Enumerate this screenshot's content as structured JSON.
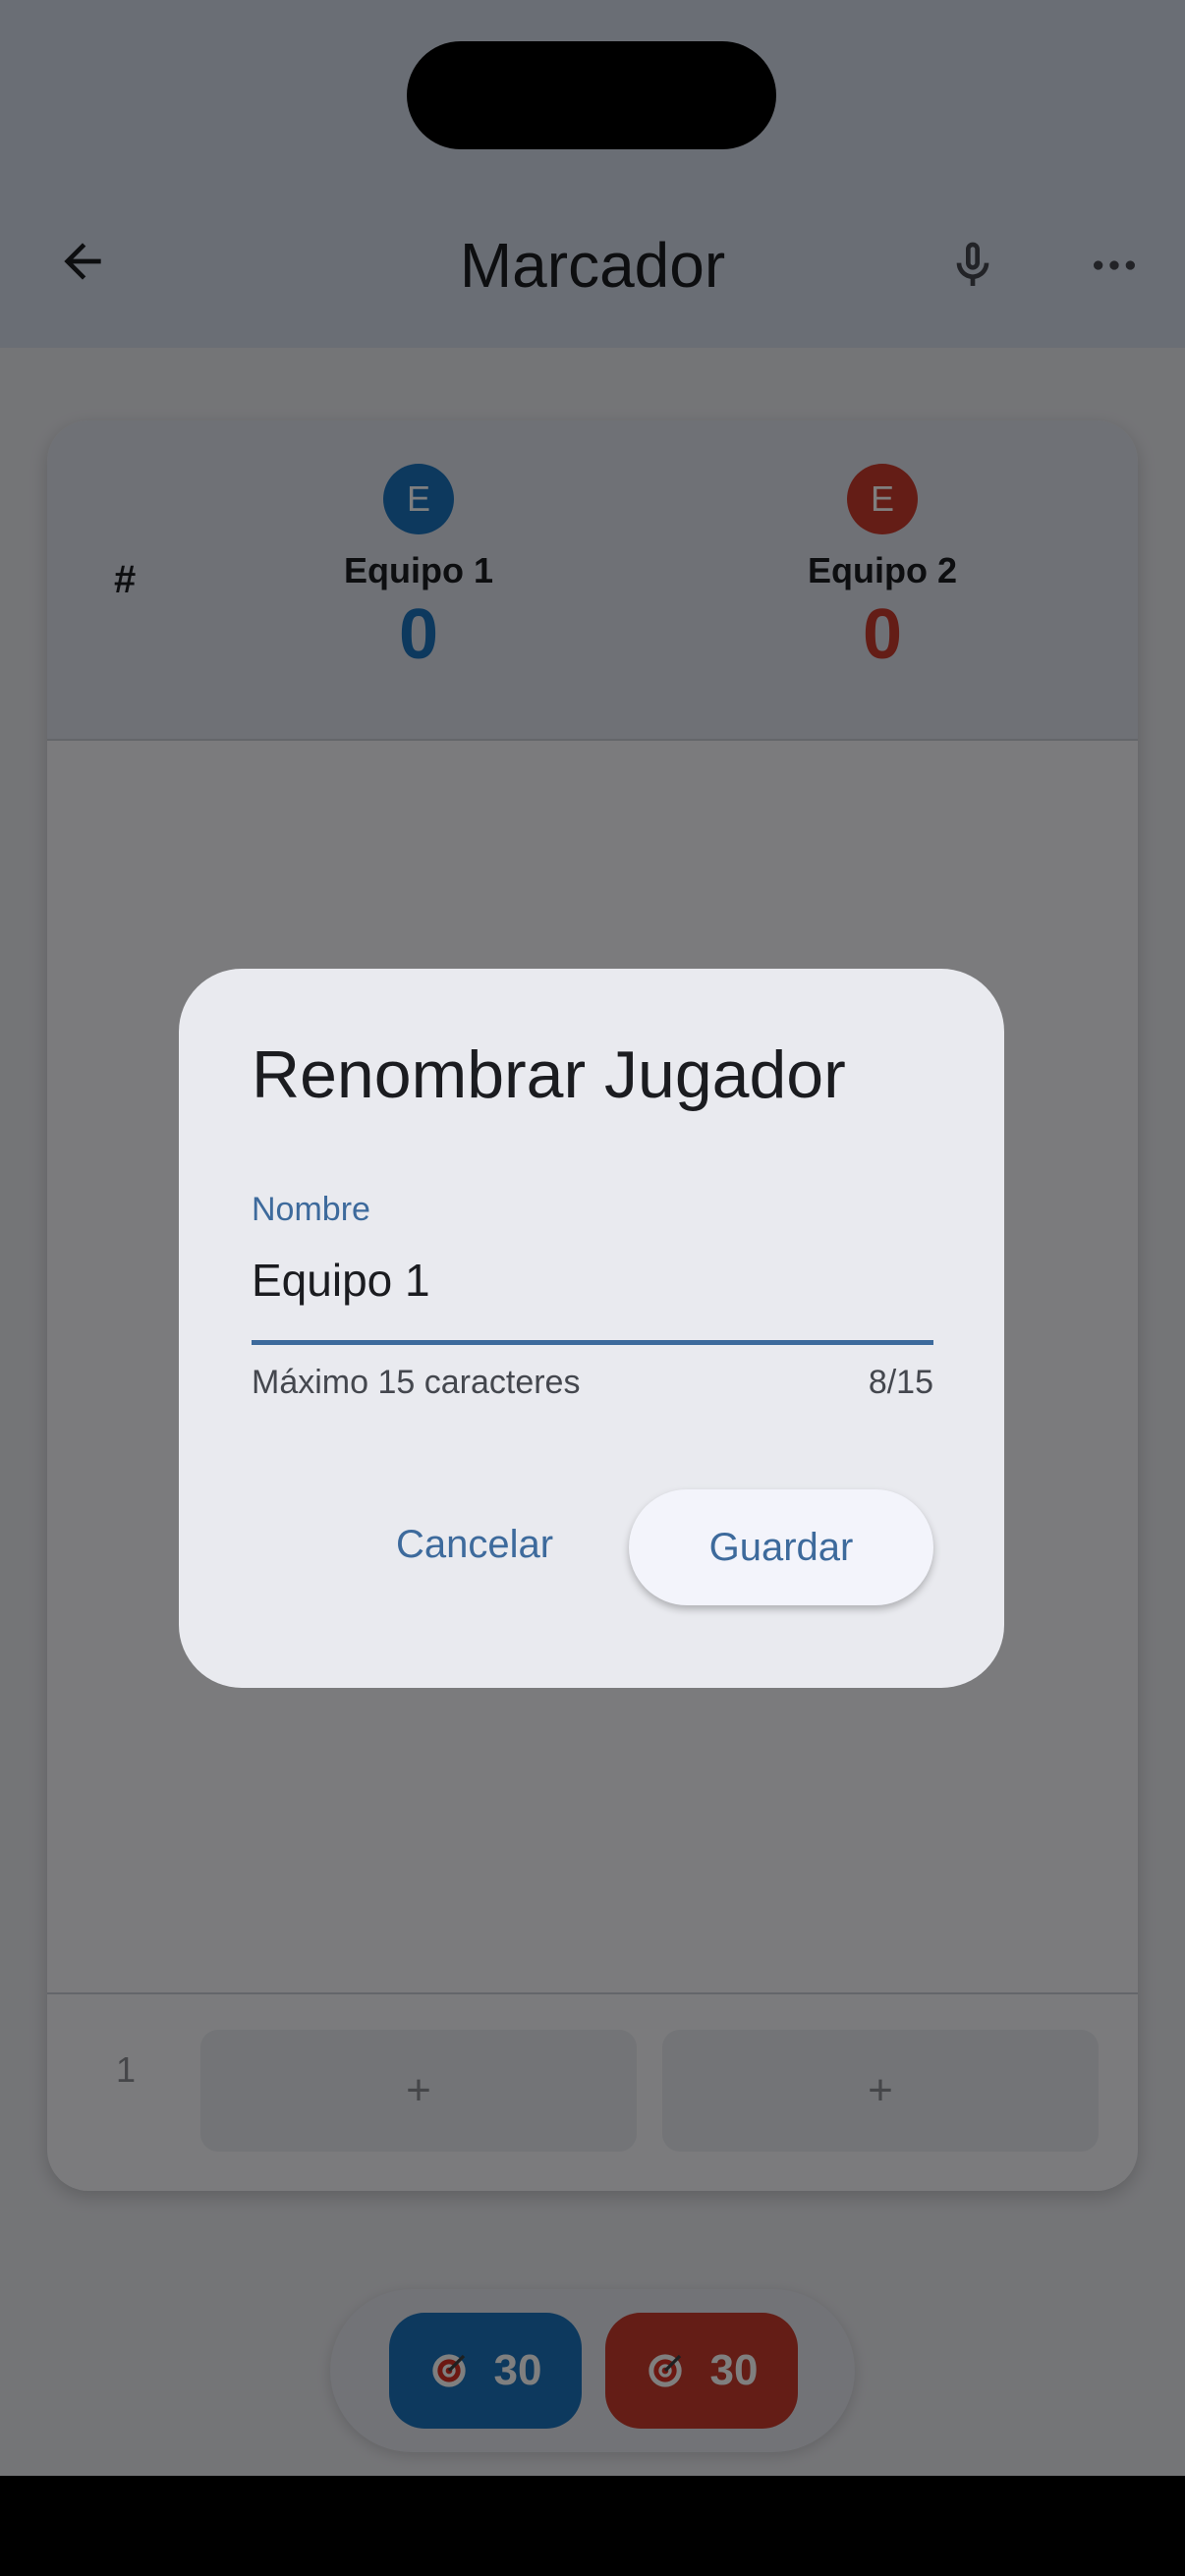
{
  "appbar": {
    "title": "Marcador",
    "back_icon": "arrow-left-icon",
    "mic_icon": "microphone-icon",
    "more_icon": "more-horizontal-icon"
  },
  "scoreboard": {
    "row_header": "#",
    "teams": [
      {
        "initial": "E",
        "name": "Equipo 1",
        "score": "0",
        "color": "#1a73bd"
      },
      {
        "initial": "E",
        "name": "Equipo 2",
        "score": "0",
        "color": "#c93a2c"
      }
    ],
    "current_round": "1",
    "add_label": "+"
  },
  "target": {
    "team1_value": "30",
    "team2_value": "30",
    "icon": "dart-target-icon"
  },
  "dialog": {
    "title": "Renombrar Jugador",
    "field_label": "Nombre",
    "field_value": "Equipo 1",
    "helper": "Máximo 15 caracteres",
    "counter": "8/15",
    "cancel_label": "Cancelar",
    "save_label": "Guardar"
  },
  "colors": {
    "accent": "#3d6a9c",
    "team1": "#1a73bd",
    "team2": "#c93a2c"
  }
}
